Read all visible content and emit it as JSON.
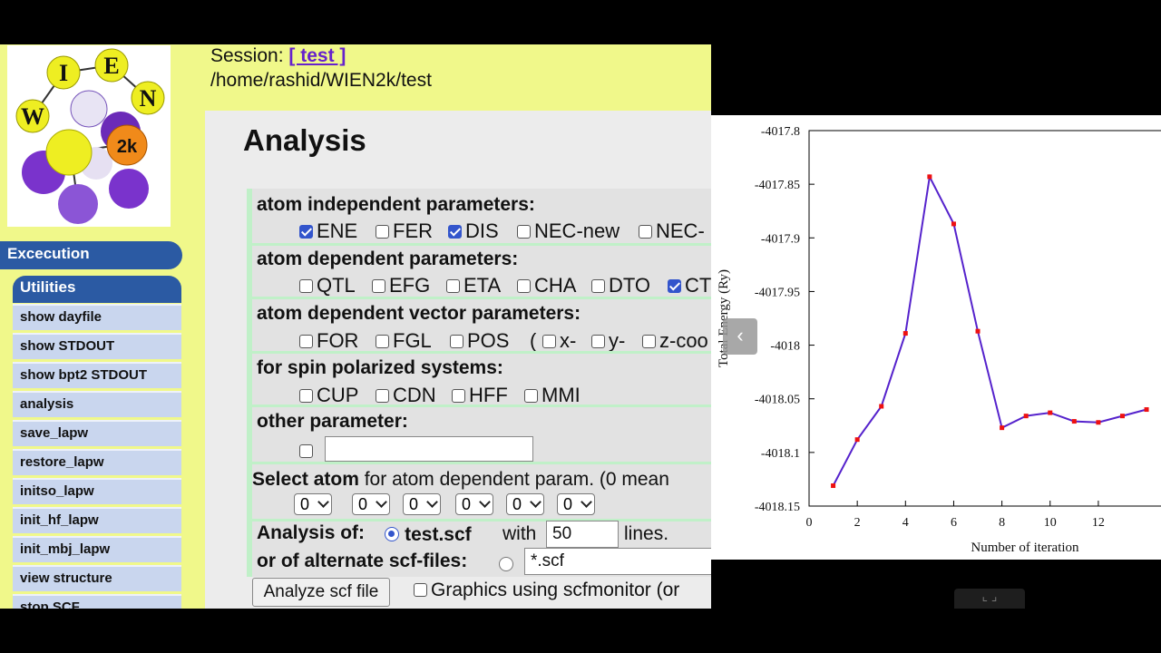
{
  "session": {
    "label": "Session:",
    "name": "[ test ]",
    "path": "/home/rashid/WIEN2k/test"
  },
  "sidebar": {
    "section_execution": "Excecution",
    "section_utilities": "Utilities",
    "items": [
      {
        "label": "show dayfile"
      },
      {
        "label": "show STDOUT"
      },
      {
        "label": "show bpt2 STDOUT"
      },
      {
        "label": "analysis"
      },
      {
        "label": "save_lapw"
      },
      {
        "label": "restore_lapw"
      },
      {
        "label": "initso_lapw"
      },
      {
        "label": "init_hf_lapw"
      },
      {
        "label": "init_mbj_lapw"
      },
      {
        "label": "view structure"
      },
      {
        "label": "stop SCF"
      }
    ]
  },
  "main": {
    "title": "Analysis",
    "atom_independent": {
      "label": "atom independent parameters:",
      "options": [
        {
          "label": "ENE",
          "checked": true
        },
        {
          "label": "FER",
          "checked": false
        },
        {
          "label": "DIS",
          "checked": true
        },
        {
          "label": "NEC-new",
          "checked": false
        },
        {
          "label": "NEC-",
          "checked": false
        }
      ]
    },
    "atom_dependent": {
      "label": "atom dependent parameters:",
      "options": [
        {
          "label": "QTL",
          "checked": false
        },
        {
          "label": "EFG",
          "checked": false
        },
        {
          "label": "ETA",
          "checked": false
        },
        {
          "label": "CHA",
          "checked": false
        },
        {
          "label": "DTO",
          "checked": false
        },
        {
          "label": "CT",
          "checked": true
        }
      ]
    },
    "atom_vector": {
      "label": "atom dependent vector parameters:",
      "options": [
        {
          "label": "FOR",
          "checked": false
        },
        {
          "label": "FGL",
          "checked": false
        },
        {
          "label": "POS",
          "checked": false
        }
      ],
      "paren": "(",
      "coords": [
        {
          "label": "x-",
          "checked": false
        },
        {
          "label": "y-",
          "checked": false
        },
        {
          "label": "z-coo",
          "checked": false
        }
      ]
    },
    "spin": {
      "label": "for spin polarized systems:",
      "options": [
        {
          "label": "CUP",
          "checked": false
        },
        {
          "label": "CDN",
          "checked": false
        },
        {
          "label": "HFF",
          "checked": false
        },
        {
          "label": "MMI",
          "checked": false
        }
      ]
    },
    "other": {
      "label": "other parameter:",
      "value": ""
    },
    "select_atom": {
      "label": "Select atom",
      "suffix": " for atom dependent param. (0 mean",
      "selects": [
        "0",
        "0",
        "0",
        "0",
        "0",
        "0"
      ]
    },
    "analysis_of": {
      "label": "Analysis of:",
      "file": "test.scf",
      "with": "with",
      "lines_value": "50",
      "lines": "lines."
    },
    "alternate": {
      "label": "or of alternate scf-files:",
      "value": "*.scf"
    },
    "analyze_button": "Analyze scf file",
    "graphics_label": "Graphics using scfmonitor (or"
  },
  "chart_data": {
    "type": "line",
    "title": "",
    "xlabel": "Number of iteration",
    "ylabel": "Total Energy (Ry)",
    "xlim": [
      0,
      14.6
    ],
    "ylim": [
      -4018.15,
      -4017.8
    ],
    "xticks": [
      0,
      2,
      4,
      6,
      8,
      10,
      12
    ],
    "yticks": [
      -4017.8,
      -4017.85,
      -4017.9,
      -4017.95,
      -4018,
      -4018.05,
      -4018.1,
      -4018.15
    ],
    "ytick_labels": [
      "-4017.8",
      "-4017.85",
      "-4017.9",
      "-4017.95",
      "-4018",
      "-4018.05",
      "-4018.1",
      "-4018.15"
    ],
    "line_color": "#5522cc",
    "marker_color": "#ee1111",
    "series": [
      {
        "x": [
          1,
          2,
          3,
          4,
          5,
          6,
          7,
          8,
          9,
          10,
          11,
          12,
          13,
          14
        ],
        "values": [
          -4018.131,
          -4018.088,
          -4018.057,
          -4017.989,
          -4017.843,
          -4017.887,
          -4017.987,
          -4018.077,
          -4018.066,
          -4018.063,
          -4018.071,
          -4018.072,
          -4018.066,
          -4018.06
        ]
      }
    ]
  }
}
